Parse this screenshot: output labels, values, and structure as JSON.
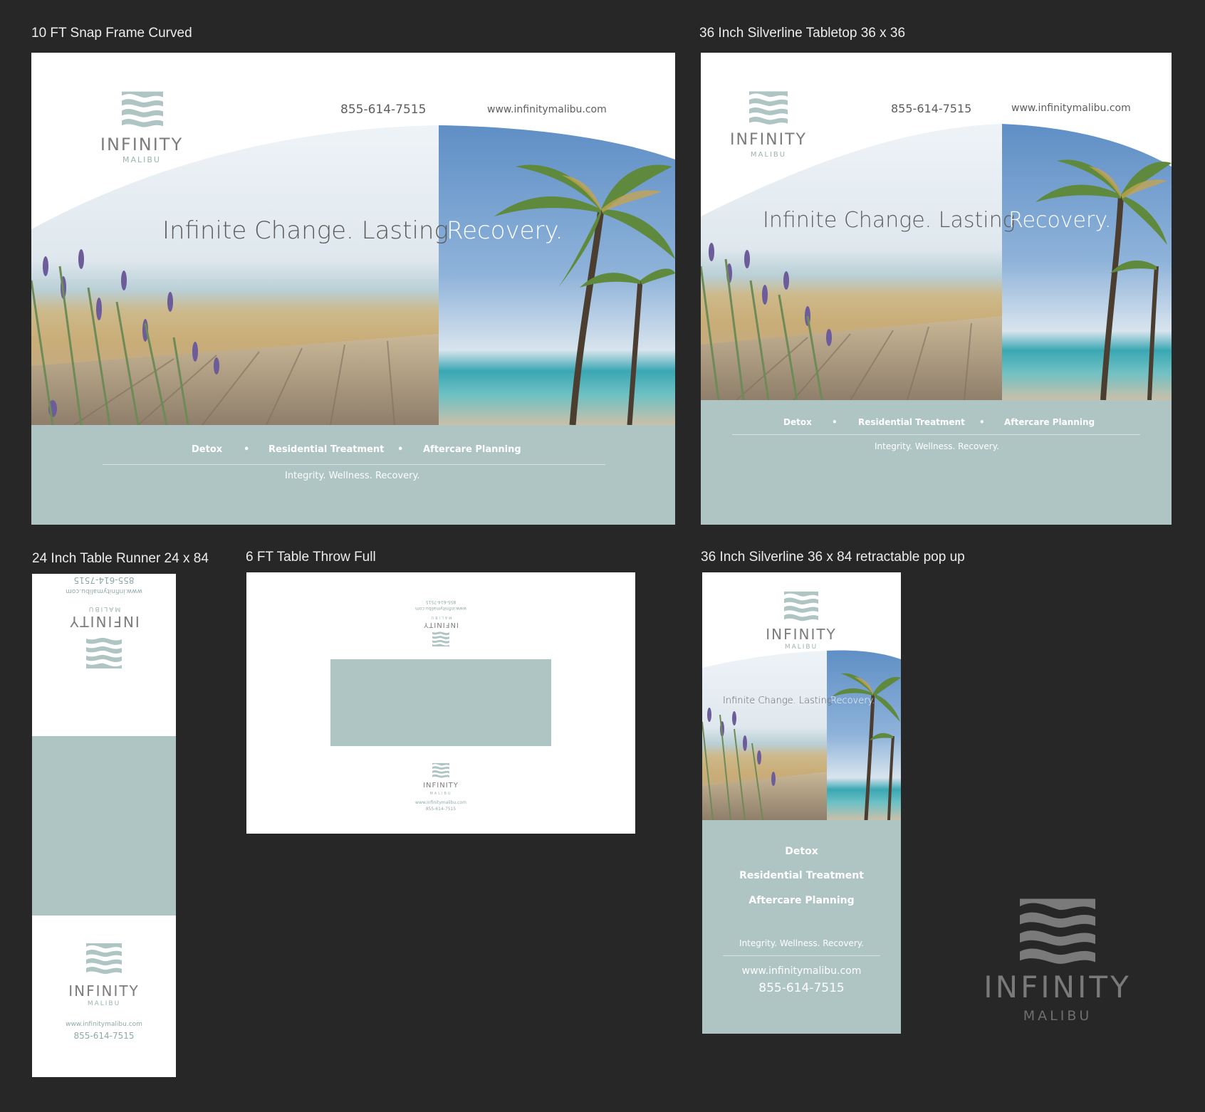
{
  "brand": {
    "name": "INFINITY",
    "sub": "MALIBU",
    "color_teal": "#aec5c3",
    "color_gray": "#7c7c7c"
  },
  "contact": {
    "phone": "855-614-7515",
    "web": "www.infinitymalibu.com"
  },
  "headline": {
    "part1": "Infinite Change. Lasting",
    "part2": "Recovery."
  },
  "services": [
    "Detox",
    "Residential Treatment",
    "Aftercare Planning"
  ],
  "tagline": "Integrity. Wellness. Recovery.",
  "bullet": "•",
  "mockups": {
    "snap_frame": {
      "label": "10 FT Snap Frame Curved"
    },
    "tabletop": {
      "label": "36 Inch Silverline Tabletop 36 x 36"
    },
    "runner": {
      "label": "24 Inch Table Runner 24 x 84"
    },
    "throw": {
      "label": "6 FT Table Throw Full"
    },
    "popup": {
      "label": "36 Inch Silverline 36 x 84 retractable pop up"
    }
  },
  "icons": {
    "logo": "wave-logo-icon"
  }
}
